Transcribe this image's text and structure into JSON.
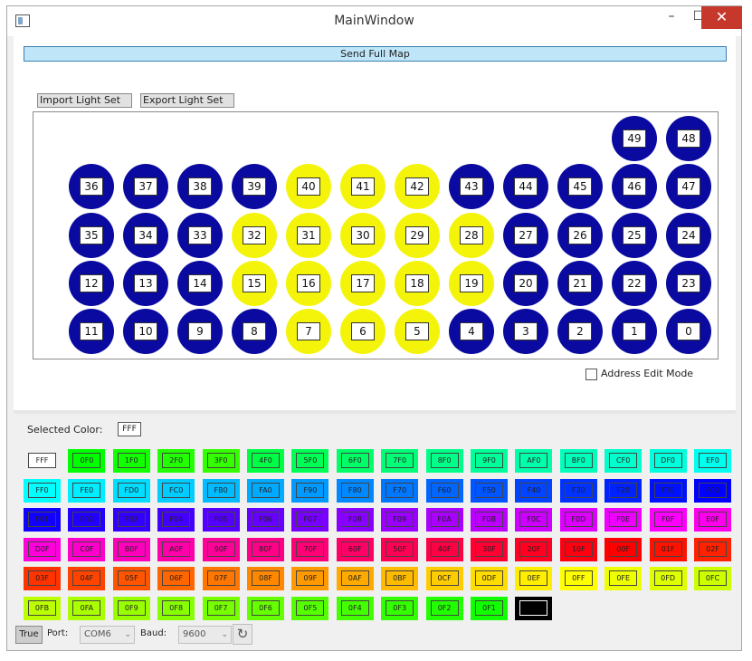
{
  "window": {
    "title": "MainWindow",
    "min": "–",
    "max": "☐",
    "close": "✕"
  },
  "toolbar": {
    "send_full_map": "Send Full Map",
    "import_light_set": "Import Light Set",
    "export_light_set": "Export Light Set"
  },
  "colors": {
    "blue": "#0a0aa0",
    "yellow": "#f4f40a"
  },
  "lights": [
    {
      "num": "49",
      "color": "blue"
    },
    {
      "num": "48",
      "color": "blue"
    },
    {
      "num": "36",
      "color": "blue"
    },
    {
      "num": "37",
      "color": "blue"
    },
    {
      "num": "38",
      "color": "blue"
    },
    {
      "num": "39",
      "color": "blue"
    },
    {
      "num": "40",
      "color": "yellow"
    },
    {
      "num": "41",
      "color": "yellow"
    },
    {
      "num": "42",
      "color": "yellow"
    },
    {
      "num": "43",
      "color": "blue"
    },
    {
      "num": "44",
      "color": "blue"
    },
    {
      "num": "45",
      "color": "blue"
    },
    {
      "num": "46",
      "color": "blue"
    },
    {
      "num": "47",
      "color": "blue"
    },
    {
      "num": "35",
      "color": "blue"
    },
    {
      "num": "34",
      "color": "blue"
    },
    {
      "num": "33",
      "color": "blue"
    },
    {
      "num": "32",
      "color": "yellow"
    },
    {
      "num": "31",
      "color": "yellow"
    },
    {
      "num": "30",
      "color": "yellow"
    },
    {
      "num": "29",
      "color": "yellow"
    },
    {
      "num": "28",
      "color": "yellow"
    },
    {
      "num": "27",
      "color": "blue"
    },
    {
      "num": "26",
      "color": "blue"
    },
    {
      "num": "25",
      "color": "blue"
    },
    {
      "num": "24",
      "color": "blue"
    },
    {
      "num": "12",
      "color": "blue"
    },
    {
      "num": "13",
      "color": "blue"
    },
    {
      "num": "14",
      "color": "blue"
    },
    {
      "num": "15",
      "color": "yellow"
    },
    {
      "num": "16",
      "color": "yellow"
    },
    {
      "num": "17",
      "color": "yellow"
    },
    {
      "num": "18",
      "color": "yellow"
    },
    {
      "num": "19",
      "color": "yellow"
    },
    {
      "num": "20",
      "color": "blue"
    },
    {
      "num": "21",
      "color": "blue"
    },
    {
      "num": "22",
      "color": "blue"
    },
    {
      "num": "23",
      "color": "blue"
    },
    {
      "num": "11",
      "color": "blue"
    },
    {
      "num": "10",
      "color": "blue"
    },
    {
      "num": "9",
      "color": "blue"
    },
    {
      "num": "8",
      "color": "blue"
    },
    {
      "num": "7",
      "color": "yellow"
    },
    {
      "num": "6",
      "color": "yellow"
    },
    {
      "num": "5",
      "color": "yellow"
    },
    {
      "num": "4",
      "color": "blue"
    },
    {
      "num": "3",
      "color": "blue"
    },
    {
      "num": "2",
      "color": "blue"
    },
    {
      "num": "1",
      "color": "blue"
    },
    {
      "num": "0",
      "color": "blue"
    }
  ],
  "address_edit_mode": {
    "label": "Address Edit Mode",
    "checked": false
  },
  "selected_color": {
    "label": "Selected Color:",
    "value": "FFF",
    "hex": "#ffffff"
  },
  "palette": [
    {
      "label": "FFF",
      "hex": "#ffffff"
    },
    {
      "label": "0F0",
      "hex": "#00ff00"
    },
    {
      "label": "1F0",
      "hex": "#11ff00"
    },
    {
      "label": "2F0",
      "hex": "#22ff00"
    },
    {
      "label": "3F0",
      "hex": "#33ff00"
    },
    {
      "label": "4F0",
      "hex": "#00ff44"
    },
    {
      "label": "5F0",
      "hex": "#00ff55"
    },
    {
      "label": "6F0",
      "hex": "#00ff66"
    },
    {
      "label": "7F0",
      "hex": "#00ff77"
    },
    {
      "label": "8F0",
      "hex": "#00ff88"
    },
    {
      "label": "9F0",
      "hex": "#00ff99"
    },
    {
      "label": "AF0",
      "hex": "#00ffaa"
    },
    {
      "label": "BF0",
      "hex": "#00ffbb"
    },
    {
      "label": "CF0",
      "hex": "#00ffcc"
    },
    {
      "label": "DF0",
      "hex": "#00ffdd"
    },
    {
      "label": "EF0",
      "hex": "#00ffee"
    },
    {
      "label": "FF0",
      "hex": "#00ffff"
    },
    {
      "label": "FE0",
      "hex": "#00eeff"
    },
    {
      "label": "FD0",
      "hex": "#00ddff"
    },
    {
      "label": "FC0",
      "hex": "#00ccff"
    },
    {
      "label": "FB0",
      "hex": "#00bbff"
    },
    {
      "label": "FA0",
      "hex": "#00aaff"
    },
    {
      "label": "F90",
      "hex": "#0099ff"
    },
    {
      "label": "F80",
      "hex": "#0088ff"
    },
    {
      "label": "F70",
      "hex": "#0077ff"
    },
    {
      "label": "F60",
      "hex": "#0066ff"
    },
    {
      "label": "F50",
      "hex": "#0055ff"
    },
    {
      "label": "F40",
      "hex": "#0044ff"
    },
    {
      "label": "F30",
      "hex": "#0033ff"
    },
    {
      "label": "F20",
      "hex": "#0022ff"
    },
    {
      "label": "F10",
      "hex": "#0011ff"
    },
    {
      "label": "F00",
      "hex": "#0000ff"
    },
    {
      "label": "F01",
      "hex": "#1100ff"
    },
    {
      "label": "F02",
      "hex": "#2200ff"
    },
    {
      "label": "F03",
      "hex": "#3300ff"
    },
    {
      "label": "F04",
      "hex": "#4400ff"
    },
    {
      "label": "F05",
      "hex": "#5500ff"
    },
    {
      "label": "F06",
      "hex": "#6600ff"
    },
    {
      "label": "F07",
      "hex": "#7700ff"
    },
    {
      "label": "F08",
      "hex": "#8800ff"
    },
    {
      "label": "F09",
      "hex": "#9900ff"
    },
    {
      "label": "F0A",
      "hex": "#aa00ff"
    },
    {
      "label": "F0B",
      "hex": "#bb00ff"
    },
    {
      "label": "F0C",
      "hex": "#cc00ff"
    },
    {
      "label": "F0D",
      "hex": "#dd00ff"
    },
    {
      "label": "F0E",
      "hex": "#ee00ff"
    },
    {
      "label": "F0F",
      "hex": "#ff00ff"
    },
    {
      "label": "E0F",
      "hex": "#ff00ee"
    },
    {
      "label": "D0F",
      "hex": "#ff00dd"
    },
    {
      "label": "C0F",
      "hex": "#ff00cc"
    },
    {
      "label": "B0F",
      "hex": "#ff00bb"
    },
    {
      "label": "A0F",
      "hex": "#ff00aa"
    },
    {
      "label": "90F",
      "hex": "#ff0099"
    },
    {
      "label": "80F",
      "hex": "#ff0088"
    },
    {
      "label": "70F",
      "hex": "#ff0077"
    },
    {
      "label": "60F",
      "hex": "#ff0066"
    },
    {
      "label": "50F",
      "hex": "#ff0055"
    },
    {
      "label": "40F",
      "hex": "#ff0044"
    },
    {
      "label": "30F",
      "hex": "#ff0033"
    },
    {
      "label": "20F",
      "hex": "#ff0022"
    },
    {
      "label": "10F",
      "hex": "#ff0011"
    },
    {
      "label": "00F",
      "hex": "#ff0000"
    },
    {
      "label": "01F",
      "hex": "#ff1100"
    },
    {
      "label": "02F",
      "hex": "#ff2200"
    },
    {
      "label": "03F",
      "hex": "#ff3300"
    },
    {
      "label": "04F",
      "hex": "#ff4400"
    },
    {
      "label": "05F",
      "hex": "#ff5500"
    },
    {
      "label": "06F",
      "hex": "#ff6600"
    },
    {
      "label": "07F",
      "hex": "#ff7700"
    },
    {
      "label": "08F",
      "hex": "#ff8800"
    },
    {
      "label": "09F",
      "hex": "#ff9900"
    },
    {
      "label": "0AF",
      "hex": "#ffaa00"
    },
    {
      "label": "0BF",
      "hex": "#ffbb00"
    },
    {
      "label": "0CF",
      "hex": "#ffcc00"
    },
    {
      "label": "0DF",
      "hex": "#ffdd00"
    },
    {
      "label": "0EF",
      "hex": "#ffee00"
    },
    {
      "label": "0FF",
      "hex": "#ffff00"
    },
    {
      "label": "0FE",
      "hex": "#eeff00"
    },
    {
      "label": "0FD",
      "hex": "#ddff00"
    },
    {
      "label": "0FC",
      "hex": "#ccff00"
    },
    {
      "label": "0FB",
      "hex": "#bbff00"
    },
    {
      "label": "0FA",
      "hex": "#aaff00"
    },
    {
      "label": "0F9",
      "hex": "#99ff00"
    },
    {
      "label": "0F8",
      "hex": "#88ff00"
    },
    {
      "label": "0F7",
      "hex": "#77ff00"
    },
    {
      "label": "0F6",
      "hex": "#66ff00"
    },
    {
      "label": "0F5",
      "hex": "#55ff00"
    },
    {
      "label": "0F4",
      "hex": "#44ff00"
    },
    {
      "label": "0F3",
      "hex": "#33ff00"
    },
    {
      "label": "0F2",
      "hex": "#22ff00"
    },
    {
      "label": "0F1",
      "hex": "#11ff00"
    },
    {
      "label": "",
      "hex": "#000000"
    }
  ],
  "bottom": {
    "connect_button": "True",
    "port_label": "Port:",
    "port_value": "COM6",
    "baud_label": "Baud:",
    "baud_value": "9600",
    "refresh_icon": "↻",
    "dropdown_arrow": "⌄"
  }
}
